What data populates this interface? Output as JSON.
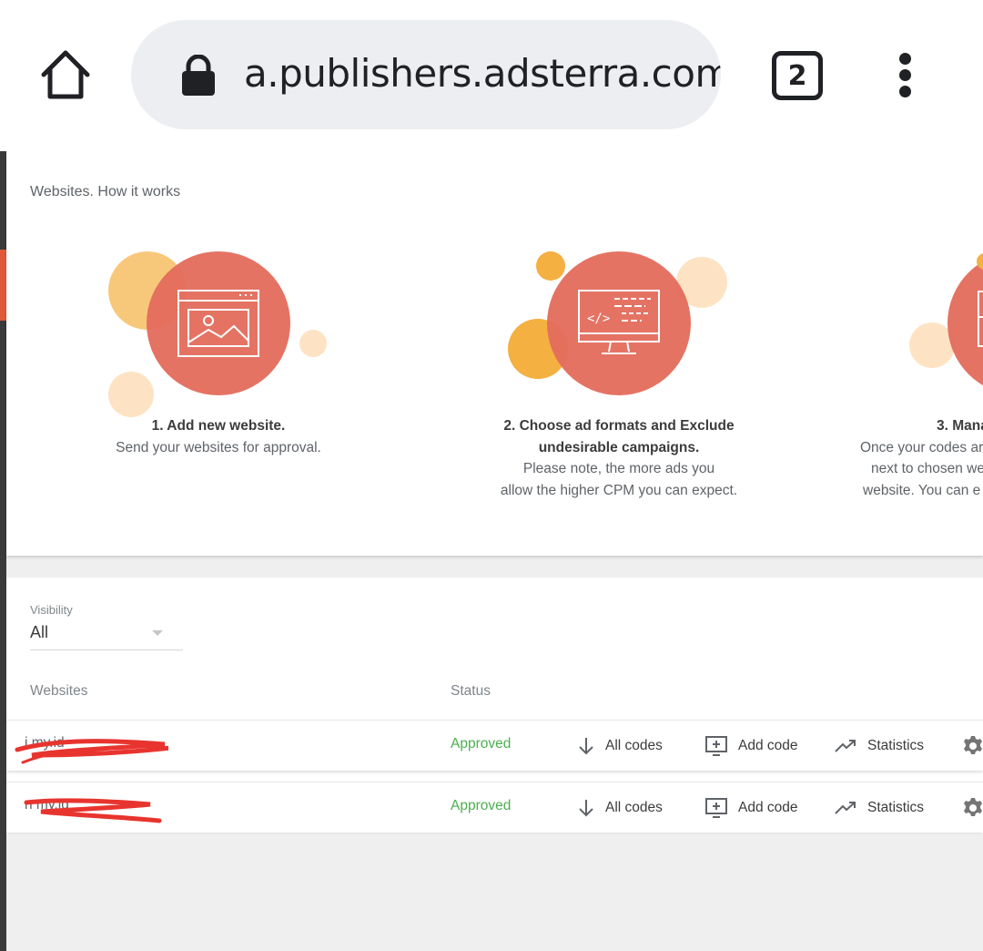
{
  "browser": {
    "url": "a.publishers.adsterra.com",
    "tab_count": "2",
    "icons": [
      "home-icon",
      "lock-icon",
      "tabs-icon",
      "more-vert-icon"
    ]
  },
  "how_it_works": {
    "title": "Websites. How it works",
    "steps": [
      {
        "heading": "1. Add new website.",
        "lines": [
          "Send your websites for approval."
        ]
      },
      {
        "heading_lines": [
          "2. Choose ad formats and Exclude",
          "undesirable campaigns."
        ],
        "lines": [
          "Please note, the more ads you",
          "allow the higher CPM you can expect."
        ]
      },
      {
        "heading": "3. Mana",
        "lines": [
          "Once your codes are",
          "next to chosen we",
          "website. You can e"
        ]
      }
    ],
    "colors": {
      "primary_circle": "#e36b5c",
      "accent_dark": "#f7c26b",
      "accent_light": "#fde3c4",
      "accent_mid": "#f4b041"
    }
  },
  "filters": {
    "visibility_label": "Visibility",
    "visibility_value": "All"
  },
  "table": {
    "columns": {
      "websites": "Websites",
      "status": "Status"
    },
    "rows": [
      {
        "site": "i              my.id",
        "status": "Approved"
      },
      {
        "site": "n              my.id",
        "status": "Approved"
      }
    ],
    "actions": {
      "all_codes": "All codes",
      "add_code": "Add code",
      "statistics": "Statistics"
    },
    "status_color": "#4caf50"
  }
}
